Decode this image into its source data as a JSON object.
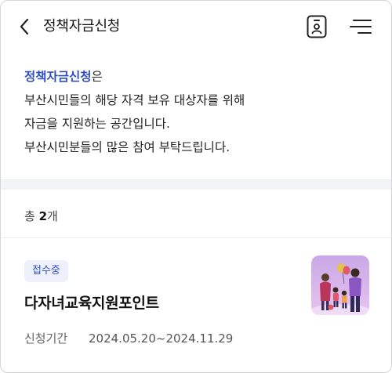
{
  "header": {
    "title": "정책자금신청",
    "back_icon": "chevron-left-icon",
    "id_icon": "id-card-icon",
    "menu_icon": "hamburger-menu-icon"
  },
  "intro": {
    "highlight": "정책자금신청",
    "suffix": "은",
    "line2": "부산시민들의 해당 자격 보유 대상자를 위해",
    "line3": "자금을 지원하는 공간입니다.",
    "line4": "부산시민분들의 많은 참여 부탁드립니다.",
    "highlight_color": "#2f4fc0"
  },
  "summary": {
    "prefix": "총",
    "count": "2",
    "unit": "개"
  },
  "items": [
    {
      "status": "접수중",
      "title": "다자녀교육지원포인트",
      "period_label": "신청기간",
      "period_value": "2024.05.20~2024.11.29",
      "thumbnail_icon": "family-illustration-icon",
      "badge_color": "#3350b8"
    }
  ]
}
